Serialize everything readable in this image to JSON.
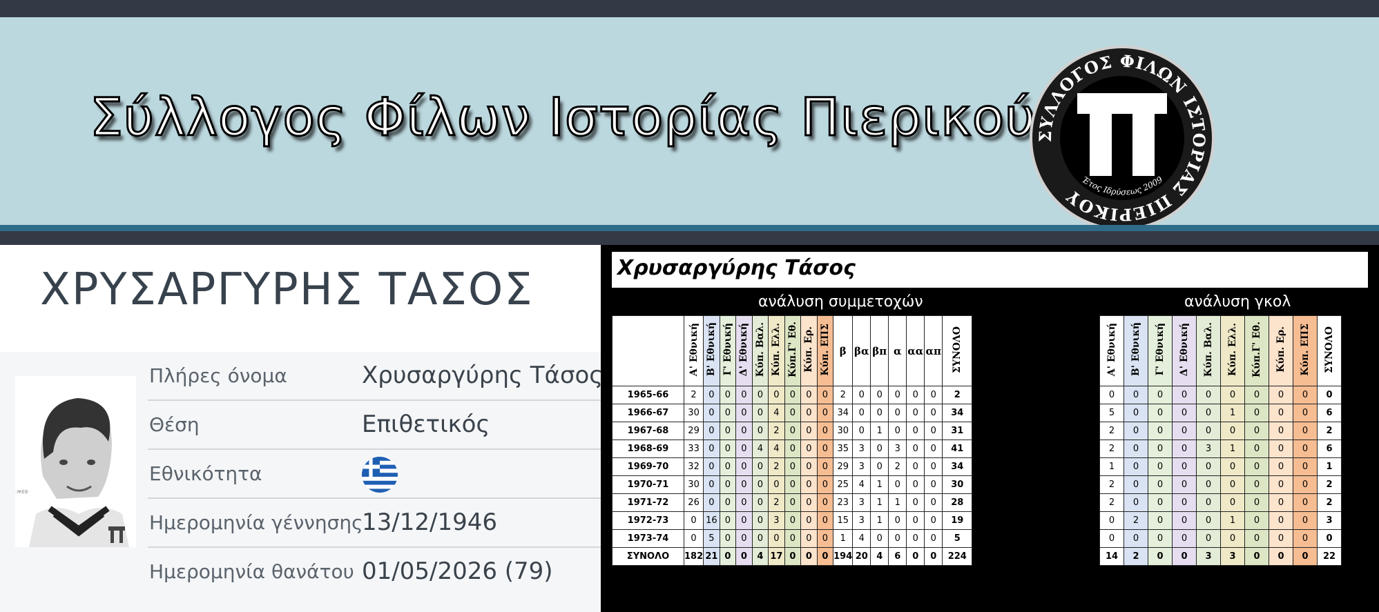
{
  "banner": {
    "title": "Σύλλογος Φίλων Ιστορίας Πιερικού",
    "logo_ring_text": "ΣΥΛΛΟΓΟΣ ΦΙΛΩΝ ΙΣΤΟΡΙΑΣ ΠΙΕΡΙΚΟΥ",
    "logo_year_text": "Έτος Ιδρύσεως 2009",
    "logo_letter": "Π"
  },
  "player": {
    "heading": "ΧΡΥΣΑΡΓΥΡΗΣ ΤΑΣΟΣ",
    "fields": [
      {
        "label": "Πλήρες όνομα",
        "value": "Χρυσαργύρης Τάσος"
      },
      {
        "label": "Θέση",
        "value": "Επιθετικός"
      },
      {
        "label": "Εθνικότητα",
        "value": "",
        "flag": "greece-flag"
      },
      {
        "label": "Ημερομηνία γέννησης",
        "value": "13/12/1946"
      },
      {
        "label": "Ημερομηνία θανάτου",
        "value": "01/05/2026 (79)"
      }
    ]
  },
  "stats": {
    "title": "Χρυσαργύρης Τάσος",
    "appearances_label": "ανάλυση συμμετοχών",
    "goals_label": "ανάλυση γκολ",
    "appearances": {
      "columns": [
        "Α' Εθνική",
        "Β' Εθνική",
        "Γ' Εθνική",
        "Δ' Εθνική",
        "Κύπ. Βαλ.",
        "Κύπ. Ελλ.",
        "Κύπ.Γ' Εθ.",
        "Κύπ. Ερ.",
        "Κύπ. ΕΠΣ",
        "β",
        "βα",
        "βπ",
        "α",
        "αα",
        "απ",
        "ΣΥΝΟΛΟ"
      ],
      "rows": [
        {
          "season": "1965-66",
          "values": [
            "2",
            "0",
            "0",
            "0",
            "0",
            "0",
            "0",
            "0",
            "0",
            "2",
            "0",
            "0",
            "0",
            "0",
            "0",
            "2"
          ]
        },
        {
          "season": "1966-67",
          "values": [
            "30",
            "0",
            "0",
            "0",
            "0",
            "4",
            "0",
            "0",
            "0",
            "34",
            "0",
            "0",
            "0",
            "0",
            "0",
            "34"
          ]
        },
        {
          "season": "1967-68",
          "values": [
            "29",
            "0",
            "0",
            "0",
            "0",
            "2",
            "0",
            "0",
            "0",
            "30",
            "0",
            "1",
            "0",
            "0",
            "0",
            "31"
          ]
        },
        {
          "season": "1968-69",
          "values": [
            "33",
            "0",
            "0",
            "0",
            "4",
            "4",
            "0",
            "0",
            "0",
            "35",
            "3",
            "0",
            "3",
            "0",
            "0",
            "41"
          ]
        },
        {
          "season": "1969-70",
          "values": [
            "32",
            "0",
            "0",
            "0",
            "0",
            "2",
            "0",
            "0",
            "0",
            "29",
            "3",
            "0",
            "2",
            "0",
            "0",
            "34"
          ]
        },
        {
          "season": "1970-71",
          "values": [
            "30",
            "0",
            "0",
            "0",
            "0",
            "0",
            "0",
            "0",
            "0",
            "25",
            "4",
            "1",
            "0",
            "0",
            "0",
            "30"
          ]
        },
        {
          "season": "1971-72",
          "values": [
            "26",
            "0",
            "0",
            "0",
            "0",
            "2",
            "0",
            "0",
            "0",
            "23",
            "3",
            "1",
            "1",
            "0",
            "0",
            "28"
          ]
        },
        {
          "season": "1972-73",
          "values": [
            "0",
            "16",
            "0",
            "0",
            "0",
            "3",
            "0",
            "0",
            "0",
            "15",
            "3",
            "1",
            "0",
            "0",
            "0",
            "19"
          ]
        },
        {
          "season": "1973-74",
          "values": [
            "0",
            "5",
            "0",
            "0",
            "0",
            "0",
            "0",
            "0",
            "0",
            "1",
            "4",
            "0",
            "0",
            "0",
            "0",
            "5"
          ]
        }
      ],
      "total": {
        "season": "ΣΥΝΟΛΟ",
        "values": [
          "182",
          "21",
          "0",
          "0",
          "4",
          "17",
          "0",
          "0",
          "0",
          "194",
          "20",
          "4",
          "6",
          "0",
          "0",
          "224"
        ]
      }
    },
    "goals": {
      "columns": [
        "Α' Εθνική",
        "Β' Εθνική",
        "Γ' Εθνική",
        "Δ' Εθνική",
        "Κύπ. Βαλ.",
        "Κύπ. Ελλ.",
        "Κύπ.Γ' Εθ.",
        "Κύπ. Ερ.",
        "Κύπ. ΕΠΣ",
        "ΣΥΝΟΛΟ"
      ],
      "rows": [
        [
          "0",
          "0",
          "0",
          "0",
          "0",
          "0",
          "0",
          "0",
          "0",
          "0"
        ],
        [
          "5",
          "0",
          "0",
          "0",
          "0",
          "1",
          "0",
          "0",
          "0",
          "6"
        ],
        [
          "2",
          "0",
          "0",
          "0",
          "0",
          "0",
          "0",
          "0",
          "0",
          "2"
        ],
        [
          "2",
          "0",
          "0",
          "0",
          "3",
          "1",
          "0",
          "0",
          "0",
          "6"
        ],
        [
          "1",
          "0",
          "0",
          "0",
          "0",
          "0",
          "0",
          "0",
          "0",
          "1"
        ],
        [
          "2",
          "0",
          "0",
          "0",
          "0",
          "0",
          "0",
          "0",
          "0",
          "2"
        ],
        [
          "2",
          "0",
          "0",
          "0",
          "0",
          "0",
          "0",
          "0",
          "0",
          "2"
        ],
        [
          "0",
          "2",
          "0",
          "0",
          "0",
          "1",
          "0",
          "0",
          "0",
          "3"
        ],
        [
          "0",
          "0",
          "0",
          "0",
          "0",
          "0",
          "0",
          "0",
          "0",
          "0"
        ]
      ],
      "total": [
        "14",
        "2",
        "0",
        "0",
        "3",
        "3",
        "0",
        "0",
        "0",
        "22"
      ]
    },
    "column_colors": [
      "#ffffff",
      "#d9e3f3",
      "#e4f0db",
      "#e6def0",
      "#e3ecd6",
      "#efe9c8",
      "#dde6c4",
      "#fbe3cc",
      "#f6bd92"
    ]
  }
}
